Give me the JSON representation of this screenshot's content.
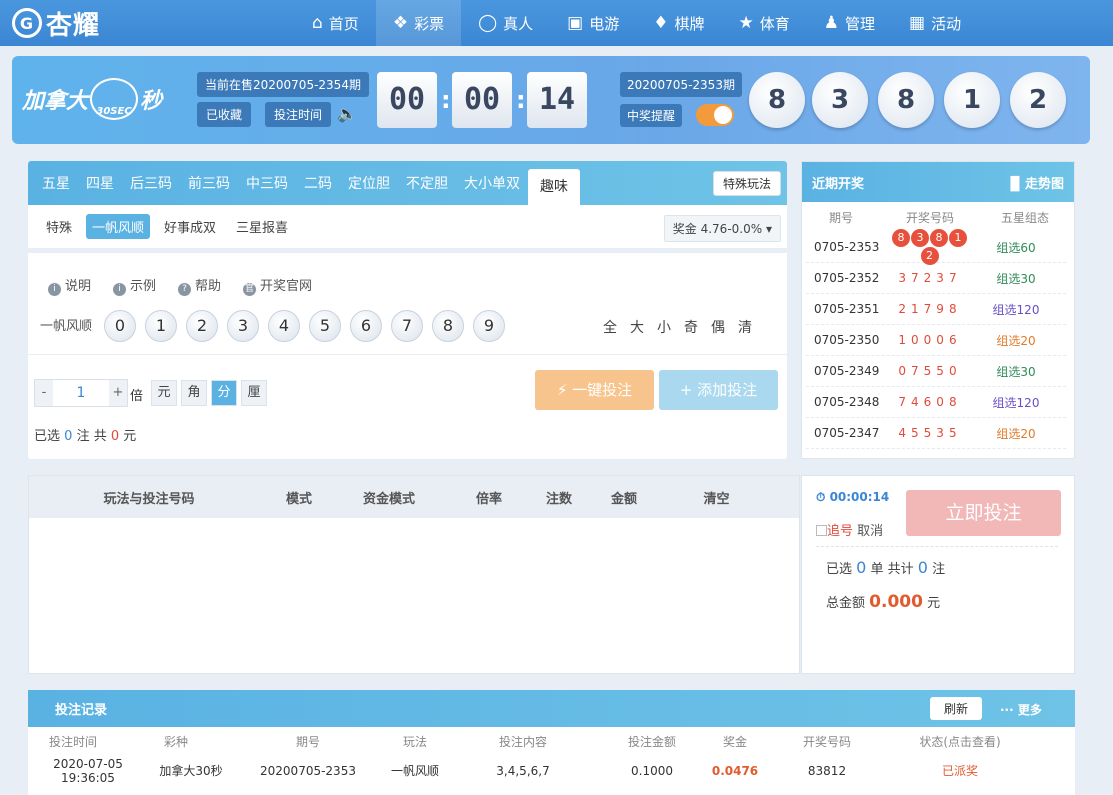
{
  "brand": {
    "logo_text": "杏耀"
  },
  "nav": [
    {
      "label": "首页",
      "icon": "home-icon"
    },
    {
      "label": "彩票",
      "icon": "ticket-icon"
    },
    {
      "label": "真人",
      "icon": "person-icon"
    },
    {
      "label": "电游",
      "icon": "arcade-icon"
    },
    {
      "label": "棋牌",
      "icon": "cards-icon"
    },
    {
      "label": "体育",
      "icon": "trophy-icon"
    },
    {
      "label": "管理",
      "icon": "users-icon"
    },
    {
      "label": "活动",
      "icon": "gift-icon"
    }
  ],
  "banner": {
    "lottery_name": "加拿大",
    "lottery_suffix": "秒",
    "logo_num": "30",
    "logo_sub": "SEC",
    "on_sale": "当前在售20200705-2354期",
    "favorited": "已收藏",
    "bet_time": "投注时间",
    "countdown": [
      "00",
      "00",
      "14"
    ],
    "last_issue": "20200705-2353期",
    "win_remind": "中奖提醒",
    "draw_balls": [
      "8",
      "3",
      "8",
      "1",
      "2"
    ]
  },
  "tabs": [
    "五星",
    "四星",
    "后三码",
    "前三码",
    "中三码",
    "二码",
    "定位胆",
    "不定胆",
    "大小单双",
    "趣味"
  ],
  "special_play": "特殊玩法",
  "subtabs": [
    "特殊",
    "一帆风顺",
    "好事成双",
    "三星报喜"
  ],
  "prize": "奖金 4.76-0.0%",
  "help": [
    "说明",
    "示例",
    "帮助",
    "开奖官网"
  ],
  "play_label": "一帆风顺",
  "digits": [
    "0",
    "1",
    "2",
    "3",
    "4",
    "5",
    "6",
    "7",
    "8",
    "9"
  ],
  "quick": [
    "全",
    "大",
    "小",
    "奇",
    "偶",
    "清"
  ],
  "multiplier": {
    "minus": "-",
    "value": "1",
    "plus": "+",
    "unit_label": "倍"
  },
  "units": [
    "元",
    "角",
    "分",
    "厘"
  ],
  "one_key": "一键投注",
  "add_bet": "添加投注",
  "selected": {
    "prefix": "已选",
    "count": "0",
    "mid": "注  共",
    "amount": "0",
    "suffix": "元"
  },
  "recent": {
    "title": "近期开奖",
    "trend": "走势图",
    "cols": [
      "期号",
      "开奖号码",
      "五星组态"
    ],
    "rows": [
      {
        "issue": "0705-2353",
        "nums": "83812",
        "group": "组选60"
      },
      {
        "issue": "0705-2352",
        "nums": "37237",
        "group": "组选30"
      },
      {
        "issue": "0705-2351",
        "nums": "21798",
        "group": "组选120"
      },
      {
        "issue": "0705-2350",
        "nums": "10006",
        "group": "组选20"
      },
      {
        "issue": "0705-2349",
        "nums": "07550",
        "group": "组选30"
      },
      {
        "issue": "0705-2348",
        "nums": "74608",
        "group": "组选120"
      },
      {
        "issue": "0705-2347",
        "nums": "45535",
        "group": "组选20"
      }
    ],
    "group_colors": {
      "组选60": "#2e8b57",
      "组选30": "#2e8b57",
      "组选120": "#6a4fc4",
      "组选20": "#e07b2a"
    }
  },
  "order_cols": [
    "玩法与投注号码",
    "模式",
    "资金模式",
    "倍率",
    "注数",
    "金额",
    "清空"
  ],
  "order_side": {
    "timer": "00:00:14",
    "chase": "追号",
    "cancel": "取消",
    "bet_now": "立即投注",
    "sel_prefix": "已选",
    "sel_units": "0",
    "sel_mid": "单 共计",
    "sel_bets": "0",
    "sel_suffix": "注",
    "total_label": "总金额",
    "total_value": "0.000",
    "total_unit": "元"
  },
  "records": {
    "title": "投注记录",
    "refresh": "刷新",
    "more": "更多",
    "cols": [
      "投注时间",
      "彩种",
      "期号",
      "玩法",
      "投注内容",
      "投注金额",
      "奖金",
      "开奖号码",
      "状态(点击查看)"
    ],
    "row": [
      "2020-07-05 19:36:05",
      "加拿大30秒",
      "20200705-2353",
      "一帆风顺",
      "3,4,5,6,7",
      "0.1000",
      "0.0476",
      "83812",
      "已派奖"
    ]
  }
}
